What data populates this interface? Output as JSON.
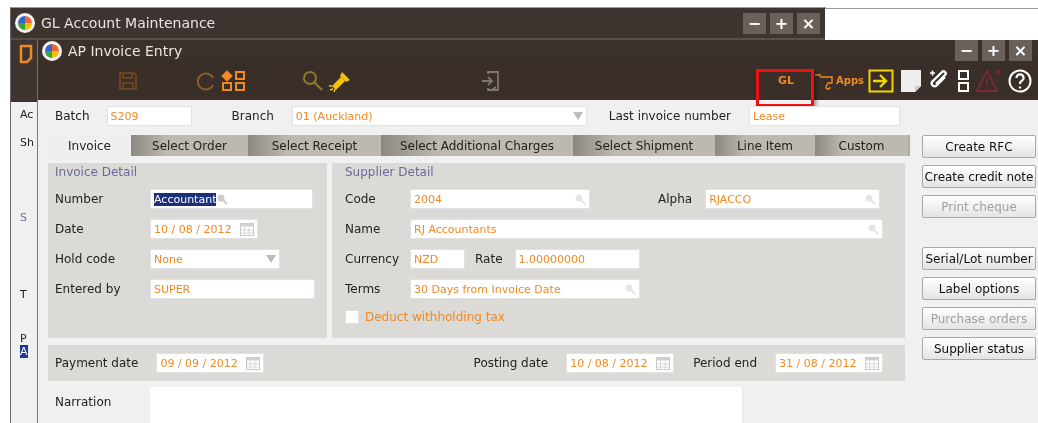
{
  "background_window": {
    "title": "GL Account Maintenance",
    "controls": [
      "−",
      "+",
      "×"
    ],
    "peek_items": [
      {
        "text": "Ac",
        "selected": false
      },
      {
        "text": "Sh",
        "selected": false
      },
      {
        "text": "S",
        "selected": false
      },
      {
        "text": "T",
        "selected": false
      },
      {
        "text": "P",
        "selected": false
      },
      {
        "text": "A",
        "selected": true
      }
    ]
  },
  "window": {
    "title": "AP Invoice Entry",
    "controls": [
      "−",
      "+",
      "×"
    ]
  },
  "toolbar": {
    "gl": {
      "label": "GL",
      "highlighted": true
    },
    "apps": {
      "label": "Apps"
    }
  },
  "header": {
    "batch": {
      "label": "Batch",
      "value": "S209"
    },
    "branch": {
      "label": "Branch",
      "value": "01 (Auckland)"
    },
    "last_invoice": {
      "label": "Last invoice number",
      "value": "Lease"
    }
  },
  "tabs": [
    {
      "label": "Invoice",
      "selected": true
    },
    {
      "label": "Select Order",
      "selected": false
    },
    {
      "label": "Select Receipt",
      "selected": false
    },
    {
      "label": "Select Additional Charges",
      "selected": false
    },
    {
      "label": "Select Shipment",
      "selected": false
    },
    {
      "label": "Line Item",
      "selected": false
    },
    {
      "label": "Custom",
      "selected": false
    }
  ],
  "invoice_detail": {
    "title": "Invoice Detail",
    "number": {
      "label": "Number",
      "value": "Accountant",
      "highlighted": true
    },
    "date": {
      "label": "Date",
      "value": "10 / 08 / 2012"
    },
    "hold_code": {
      "label": "Hold code",
      "value": "None"
    },
    "entered_by": {
      "label": "Entered by",
      "value": "SUPER"
    }
  },
  "supplier_detail": {
    "title": "Supplier Detail",
    "code": {
      "label": "Code",
      "value": "2004"
    },
    "alpha": {
      "label": "Alpha",
      "value": "RJACCO"
    },
    "name": {
      "label": "Name",
      "value": "RJ Accountants"
    },
    "currency": {
      "label": "Currency",
      "value": "NZD"
    },
    "rate": {
      "label": "Rate",
      "value": "1.00000000"
    },
    "terms": {
      "label": "Terms",
      "value": "30 Days from Invoice Date"
    },
    "withholding": {
      "label": "Deduct withholding tax",
      "checked": false
    }
  },
  "dates": {
    "payment_date": {
      "label": "Payment date",
      "value": "09 / 09 / 2012"
    },
    "posting_date": {
      "label": "Posting date",
      "value": "10 / 08 / 2012"
    },
    "period_end": {
      "label": "Period end",
      "value": "31 / 08 / 2012"
    }
  },
  "narration": {
    "label": "Narration"
  },
  "side_button_groups": [
    {
      "buttons": [
        {
          "label": "Create RFC",
          "disabled": false
        },
        {
          "label": "Create credit note",
          "disabled": false
        },
        {
          "label": "Print cheque",
          "disabled": true
        }
      ]
    },
    {
      "buttons": [
        {
          "label": "Serial/Lot number",
          "disabled": false
        },
        {
          "label": "Label options",
          "disabled": false
        },
        {
          "label": "Purchase orders",
          "disabled": true
        },
        {
          "label": "Supplier status",
          "disabled": false
        }
      ]
    }
  ]
}
